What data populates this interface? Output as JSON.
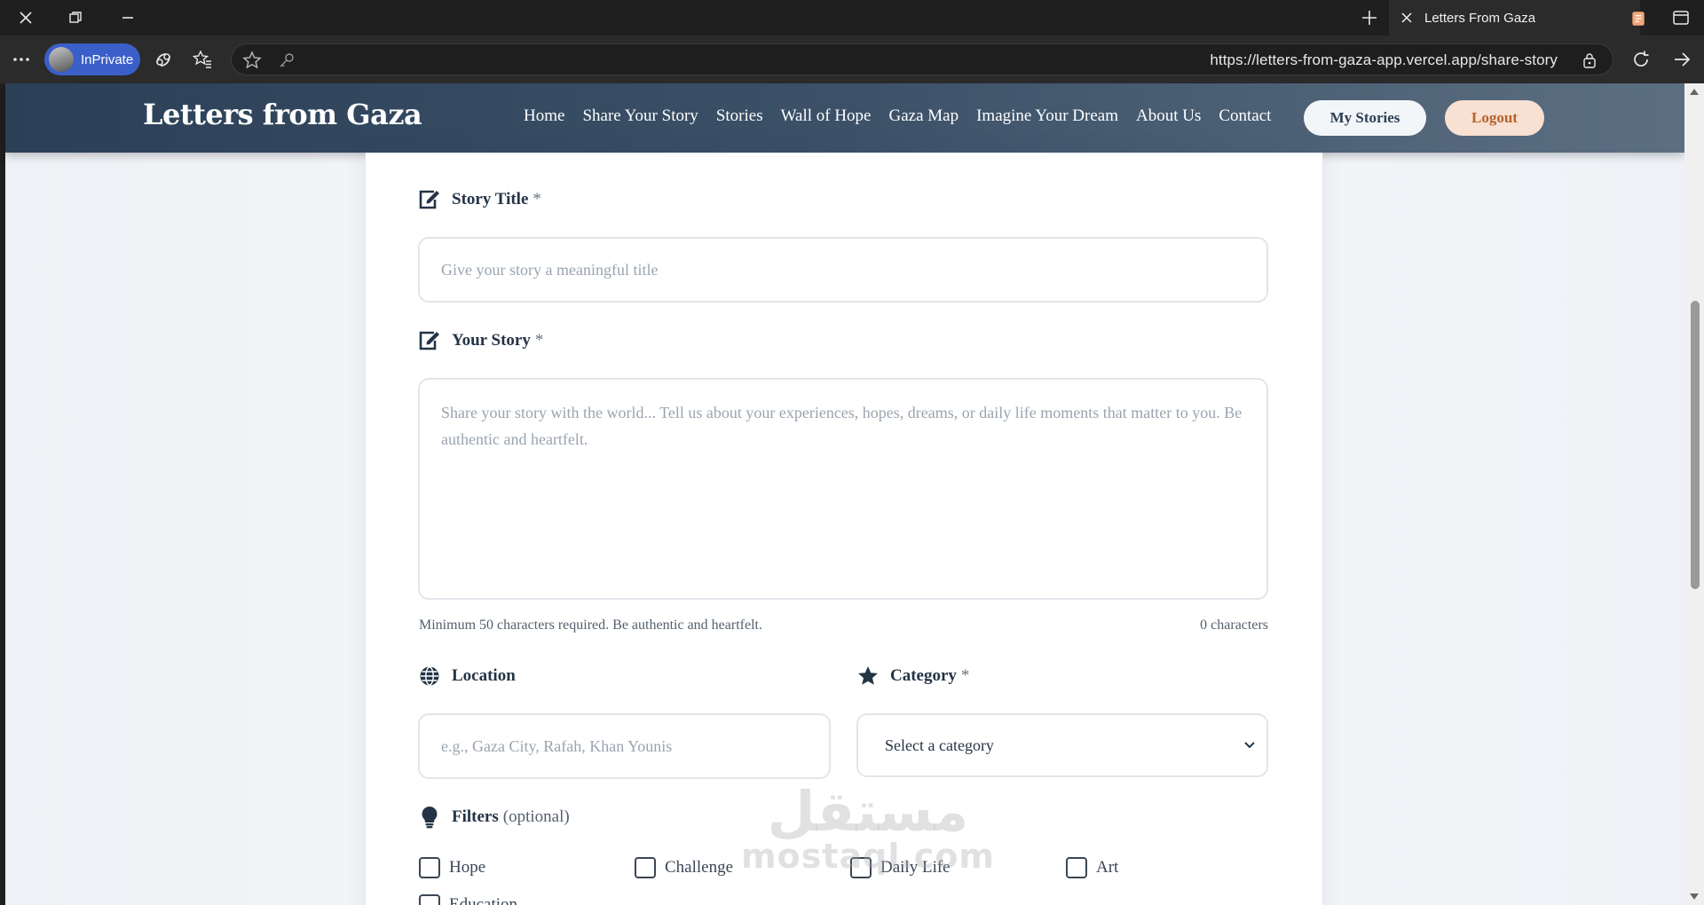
{
  "browser": {
    "tab_title": "Letters From Gaza",
    "inprivate_label": "InPrivate",
    "url": "https://letters-from-gaza-app.vercel.app/share-story"
  },
  "site": {
    "brand": "Letters from Gaza",
    "nav": [
      "Home",
      "Share Your Story",
      "Stories",
      "Wall of Hope",
      "Gaza Map",
      "Imagine Your Dream",
      "About Us",
      "Contact"
    ],
    "my_stories_label": "My Stories",
    "logout_label": "Logout"
  },
  "form": {
    "title_label": "Story Title",
    "title_required": "*",
    "title_placeholder": "Give your story a meaningful title",
    "story_label": "Your Story",
    "story_required": "*",
    "story_placeholder": "Share your story with the world... Tell us about your experiences, hopes, dreams, or daily life moments that matter to you. Be authentic and heartfelt.",
    "story_helper": "Minimum 50 characters required. Be authentic and heartfelt.",
    "char_count": "0 characters",
    "location_label": "Location",
    "location_placeholder": "e.g., Gaza City, Rafah, Khan Younis",
    "category_label": "Category",
    "category_required": "*",
    "category_selected": "Select a category",
    "filters_label": "Filters",
    "filters_optional": "(optional)",
    "filters": [
      "Hope",
      "Challenge",
      "Daily Life",
      "Art",
      "Education"
    ]
  },
  "watermark": {
    "arabic": "مستقل",
    "latin": "mostaql.com"
  },
  "colors": {
    "navbar_start": "#2b4057",
    "navbar_end": "#5c6f82",
    "accent_text": "#243447",
    "logout_bg": "#f8e0d2",
    "logout_text": "#b3632e"
  }
}
